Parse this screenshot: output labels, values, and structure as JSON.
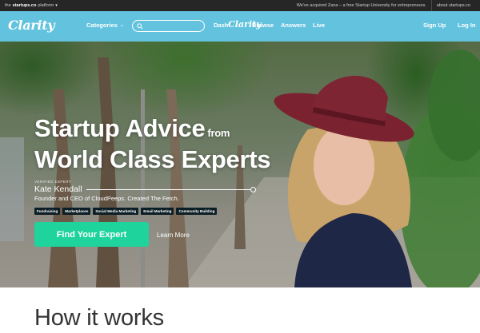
{
  "topbar": {
    "platform_prefix": "the",
    "platform_brand": "startups.co",
    "platform_suffix": "platform",
    "announcement": "We've acquired Zana – a free Startup University for entrepreneurs.",
    "about": "about startups.co"
  },
  "nav": {
    "logo": "Clarity",
    "categories": "Categories",
    "search_placeholder": "",
    "dashboard": "Dash",
    "center_logo": "Clarity",
    "browse": "Browse",
    "answers": "Answers",
    "live": "Live",
    "signup": "Sign Up",
    "login": "Log In"
  },
  "hero": {
    "headline_line1": "Startup Advice",
    "headline_from": "from",
    "headline_line2": "World Class Experts",
    "verified_label": "VERIFIED EXPERT",
    "expert_name": "Kate Kendall",
    "expert_title": "Founder and CEO of CloudPeeps. Created The Fetch.",
    "tags": [
      "Fundraising",
      "Marketplaces",
      "Social Media Marketing",
      "Email Marketing",
      "Community Building"
    ],
    "cta": "Find Your Expert",
    "learn_more": "Learn More"
  },
  "section": {
    "how_it_works": "How it works"
  },
  "colors": {
    "topbar": "#262626",
    "nav": "#63c3df",
    "cta": "#1ed39c",
    "tag_bg": "#0d1f26"
  },
  "icons": {
    "search": "search-icon",
    "categories_chevron": "chevron-down-icon",
    "platform_caret": "caret-down-icon"
  }
}
